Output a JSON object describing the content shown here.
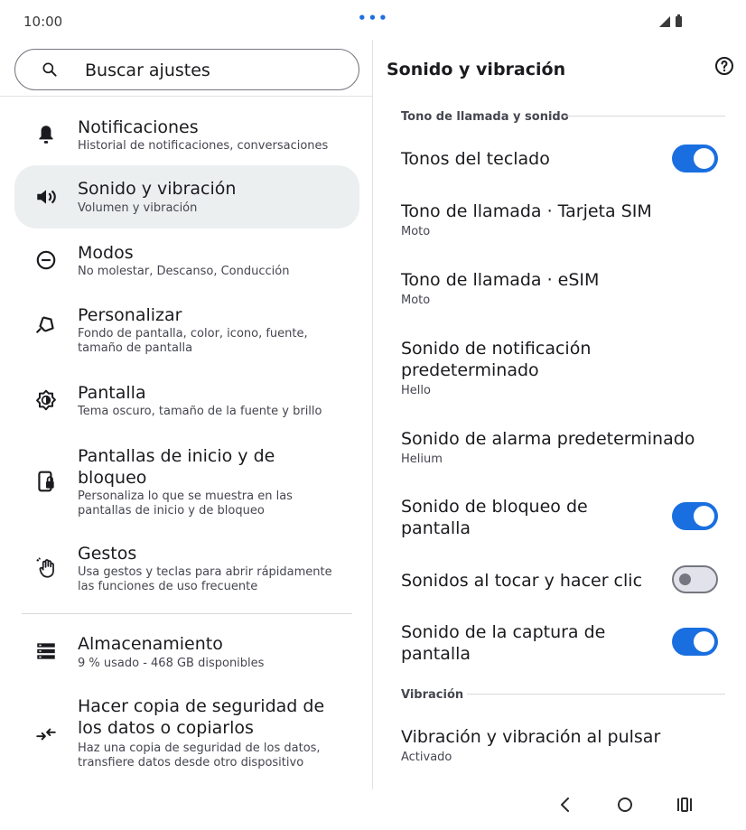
{
  "status": {
    "time": "10:00",
    "dots": "•••"
  },
  "search": {
    "placeholder": "Buscar ajustes"
  },
  "sidebar": {
    "items": [
      {
        "title": "Notificaciones",
        "sub": "Historial de notificaciones, conversaciones",
        "icon": "bell-icon"
      },
      {
        "title": "Sonido y vibración",
        "sub": "Volumen y vibración",
        "icon": "volume-icon"
      },
      {
        "title": "Modos",
        "sub": "No molestar, Descanso, Conducción",
        "icon": "dnd-icon"
      },
      {
        "title": "Personalizar",
        "sub": "Fondo de pantalla, color, icono, fuente, tamaño de pantalla",
        "icon": "brush-icon"
      },
      {
        "title": "Pantalla",
        "sub": "Tema oscuro, tamaño de la fuente y brillo",
        "icon": "brightness-icon"
      },
      {
        "title": "Pantallas de inicio y de bloqueo",
        "sub": "Personaliza lo que se muestra en las pantallas de inicio y de bloqueo",
        "icon": "lockscreen-icon"
      },
      {
        "title": "Gestos",
        "sub": "Usa gestos y teclas para abrir rápidamente las funciones de uso frecuente",
        "icon": "gesture-icon"
      },
      {
        "title": "Almacenamiento",
        "sub": "9 % usado - 468 GB disponibles",
        "icon": "storage-icon"
      },
      {
        "title": "Hacer copia de seguridad de los datos o copiarlos",
        "sub": "Haz una copia de seguridad de los datos, transfiere datos desde otro dispositivo",
        "icon": "backup-icon"
      }
    ]
  },
  "detail": {
    "title": "Sonido y vibración",
    "section1": "Tono de llamada y sonido",
    "section2": "Vibración",
    "prefs": [
      {
        "title": "Tonos del teclado",
        "sub": "",
        "toggle": true
      },
      {
        "title": "Tono de llamada · Tarjeta SIM",
        "sub": "Moto"
      },
      {
        "title": "Tono de llamada · eSIM",
        "sub": "Moto"
      },
      {
        "title": "Sonido de notificación predeterminado",
        "sub": "Hello"
      },
      {
        "title": "Sonido de alarma predeterminado",
        "sub": "Helium"
      },
      {
        "title": "Sonido de bloqueo de pantalla",
        "sub": "",
        "toggle": true
      },
      {
        "title": "Sonidos al tocar y hacer clic",
        "sub": "",
        "toggle": false
      },
      {
        "title": "Sonido de la captura de pantalla",
        "sub": "",
        "toggle": true
      },
      {
        "title": "Vibración y vibración al pulsar",
        "sub": "Activado"
      }
    ]
  },
  "colors": {
    "accent": "#1a6fe0",
    "selected_bg": "#eceff0"
  }
}
